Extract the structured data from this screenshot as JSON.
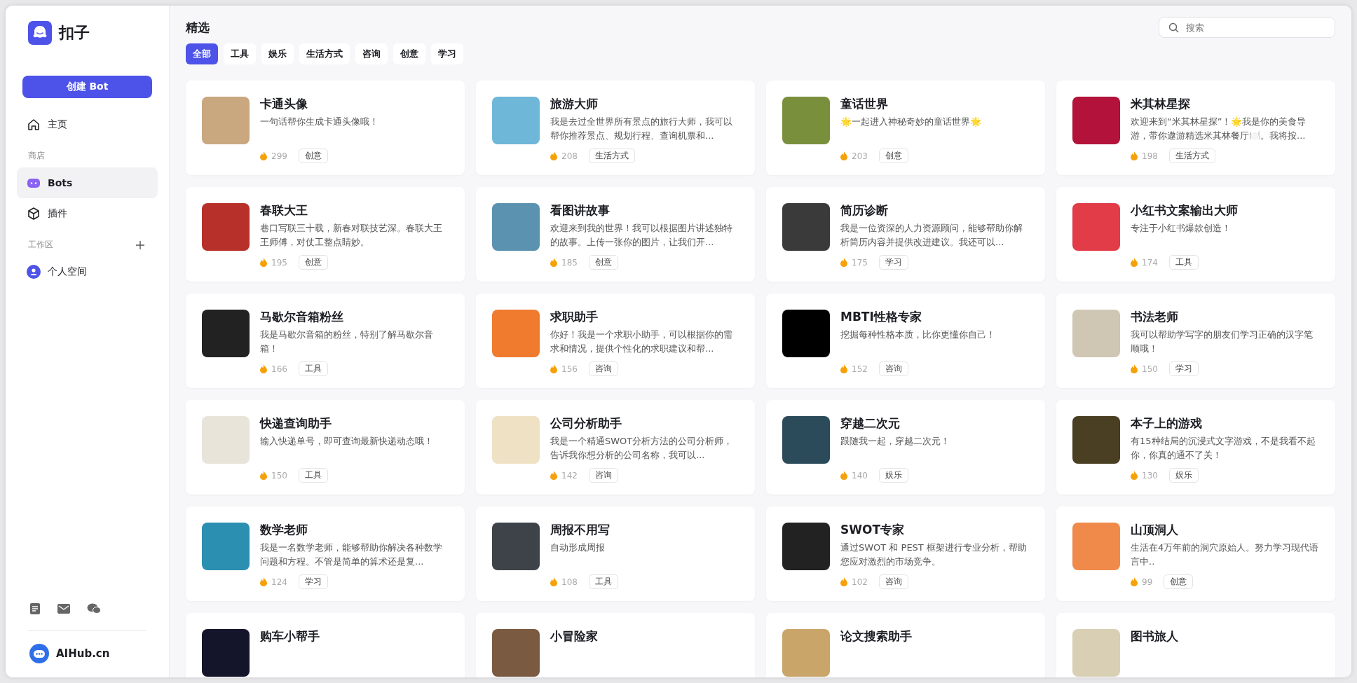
{
  "sidebar": {
    "logo_text": "扣子",
    "create_button": "创建 Bot",
    "nav": [
      {
        "kind": "home",
        "label": "主页",
        "selected": false
      },
      {
        "kind": "section",
        "label": "商店"
      },
      {
        "kind": "bots",
        "label": "Bots",
        "selected": true
      },
      {
        "kind": "plugin",
        "label": "插件",
        "selected": false
      },
      {
        "kind": "section_add",
        "label": "工作区"
      },
      {
        "kind": "space",
        "label": "个人空间",
        "selected": false
      }
    ],
    "footer_text": "AIHub.cn"
  },
  "header": {
    "title": "精选",
    "search": {
      "placeholder": "搜索"
    }
  },
  "filters": [
    {
      "label": "全部",
      "selected": true
    },
    {
      "label": "工具",
      "selected": false
    },
    {
      "label": "娱乐",
      "selected": false
    },
    {
      "label": "生活方式",
      "selected": false
    },
    {
      "label": "咨询",
      "selected": false
    },
    {
      "label": "创意",
      "selected": false
    },
    {
      "label": "学习",
      "selected": false
    }
  ],
  "cards": [
    {
      "title": "卡通头像",
      "description": "一句话帮你生成卡通头像哦！",
      "count": "299",
      "tag": "创意"
    },
    {
      "title": "旅游大师",
      "description": "我是去过全世界所有景点的旅行大师，我可以帮你推荐景点、规划行程、查询机票和...",
      "count": "208",
      "tag": "生活方式"
    },
    {
      "title": "童话世界",
      "description": "🌟一起进入神秘奇妙的童话世界🌟",
      "count": "203",
      "tag": "创意"
    },
    {
      "title": "米其林星探",
      "description": "欢迎来到“米其林星探”！🌟我是你的美食导游，带你遨游精选米其林餐厅🍽️。我将按...",
      "count": "198",
      "tag": "生活方式"
    },
    {
      "title": "春联大王",
      "description": "巷口写联三十载，新春对联技艺深。春联大王王师傅，对仗工整点睛妙。",
      "count": "195",
      "tag": "创意"
    },
    {
      "title": "看图讲故事",
      "description": "欢迎来到我的世界！我可以根据图片讲述独特的故事。上传一张你的图片，让我们开...",
      "count": "185",
      "tag": "创意"
    },
    {
      "title": "简历诊断",
      "description": "我是一位资深的人力资源顾问，能够帮助你解析简历内容并提供改进建议。我还可以...",
      "count": "175",
      "tag": "学习"
    },
    {
      "title": "小红书文案输出大师",
      "description": "专注于小红书爆款创造！",
      "count": "174",
      "tag": "工具"
    },
    {
      "title": "马歇尔音箱粉丝",
      "description": "我是马歇尔音箱的粉丝，特别了解马歇尔音箱！",
      "count": "166",
      "tag": "工具"
    },
    {
      "title": "求职助手",
      "description": "你好！我是一个求职小助手，可以根据你的需求和情况，提供个性化的求职建议和帮...",
      "count": "156",
      "tag": "咨询"
    },
    {
      "title": "MBTI性格专家",
      "description": "挖掘每种性格本质，比你更懂你自己！",
      "count": "152",
      "tag": "咨询"
    },
    {
      "title": "书法老师",
      "description": "我可以帮助学写字的朋友们学习正确的汉字笔顺哦！",
      "count": "150",
      "tag": "学习"
    },
    {
      "title": "快递查询助手",
      "description": "输入快递单号，即可查询最新快递动态哦！",
      "count": "150",
      "tag": "工具"
    },
    {
      "title": "公司分析助手",
      "description": "我是一个精通SWOT分析方法的公司分析师，告诉我你想分析的公司名称，我可以...",
      "count": "142",
      "tag": "咨询"
    },
    {
      "title": "穿越二次元",
      "description": "跟随我一起，穿越二次元！",
      "count": "140",
      "tag": "娱乐"
    },
    {
      "title": "本子上的游戏",
      "description": "有15种结局的沉浸式文字游戏，不是我看不起你，你真的通不了关！",
      "count": "130",
      "tag": "娱乐"
    },
    {
      "title": "数学老师",
      "description": "我是一名数学老师，能够帮助你解决各种数学问题和方程。不管是简单的算术还是复...",
      "count": "124",
      "tag": "学习"
    },
    {
      "title": "周报不用写",
      "description": "自动形成周报",
      "count": "108",
      "tag": "工具"
    },
    {
      "title": "SWOT专家",
      "description": "通过SWOT 和 PEST 框架进行专业分析，帮助您应对激烈的市场竞争。",
      "count": "102",
      "tag": "咨询"
    },
    {
      "title": "山顶洞人",
      "description": "生活在4万年前的洞穴原始人。努力学习现代语言中..",
      "count": "99",
      "tag": "创意"
    },
    {
      "title": "购车小帮手"
    },
    {
      "title": "小冒险家"
    },
    {
      "title": "论文搜索助手"
    },
    {
      "title": "图书旅人"
    }
  ]
}
